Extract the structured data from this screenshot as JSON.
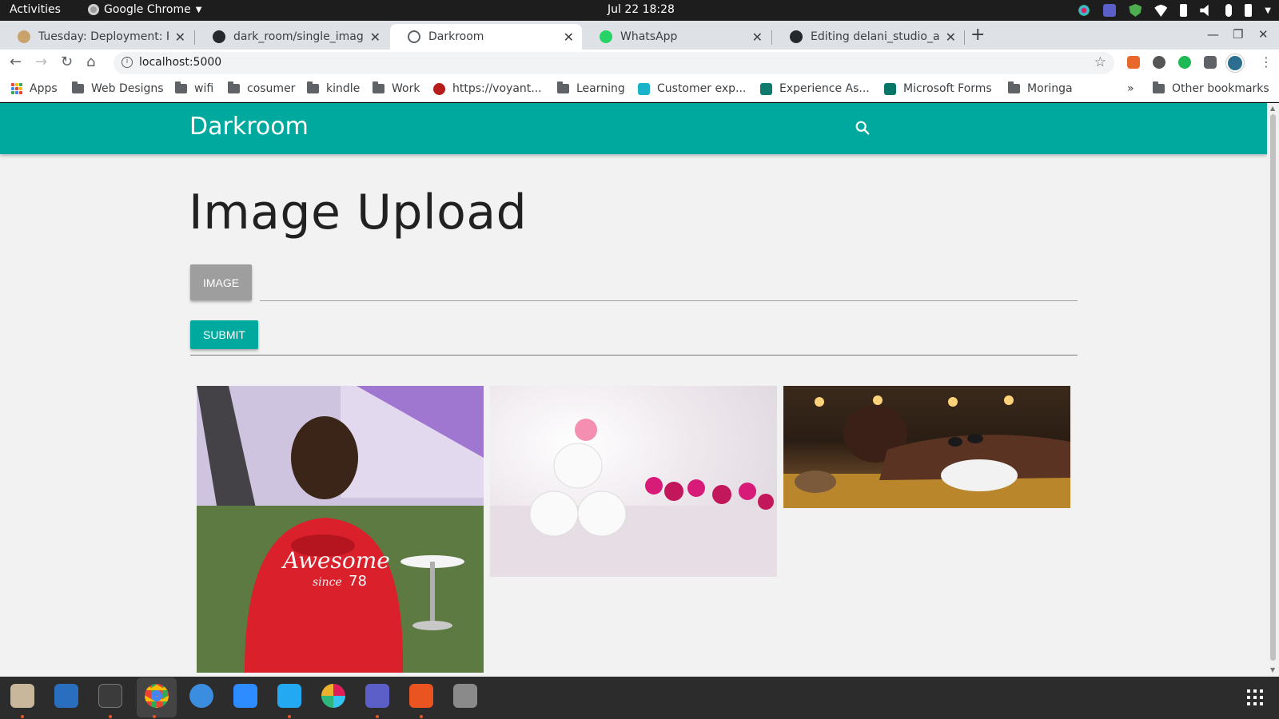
{
  "system": {
    "activities": "Activities",
    "app_name": "Google Chrome",
    "clock": "Jul 22  18:28"
  },
  "browser": {
    "tabs": [
      {
        "title": "Tuesday: Deployment: Pre",
        "active": false
      },
      {
        "title": "dark_room/single_image",
        "active": false
      },
      {
        "title": "Darkroom",
        "active": true
      },
      {
        "title": "WhatsApp",
        "active": false
      },
      {
        "title": "Editing delani_studio_app",
        "active": false
      }
    ],
    "url": "localhost:5000",
    "bookmarks": [
      {
        "label": "Apps",
        "icon": "apps-grid-icon"
      },
      {
        "label": "Web Designs",
        "icon": "folder-icon"
      },
      {
        "label": "wifi",
        "icon": "folder-icon"
      },
      {
        "label": "cosumer",
        "icon": "folder-icon"
      },
      {
        "label": "kindle",
        "icon": "folder-icon"
      },
      {
        "label": "Work",
        "icon": "folder-icon"
      },
      {
        "label": "https://voyant...",
        "icon": "voyant-icon"
      },
      {
        "label": "Learning",
        "icon": "folder-icon"
      },
      {
        "label": "Customer exp...",
        "icon": "customer-icon"
      },
      {
        "label": "Experience As...",
        "icon": "experience-icon"
      },
      {
        "label": "Microsoft Forms",
        "icon": "forms-icon"
      },
      {
        "label": "Moringa",
        "icon": "folder-icon"
      }
    ],
    "more_bookmarks": "»",
    "other_bookmarks": "Other bookmarks"
  },
  "page": {
    "brand": "Darkroom",
    "title": "Image Upload",
    "image_button": "IMAGE",
    "file_path_value": "",
    "submit_button": "SUBMIT",
    "gallery": [
      {
        "subject": "man in red hoodie",
        "printed_text": "Awesome since 78"
      },
      {
        "subject": "rolled white towels with pink orchids"
      },
      {
        "subject": "woman receiving hot stone massage"
      }
    ]
  },
  "colors": {
    "primary": "#00a99d",
    "page_bg": "#f2f2f2",
    "image_button_bg": "#9e9e9e"
  },
  "dock": {
    "apps": [
      "files",
      "text-editor",
      "terminal",
      "chrome",
      "simplenote",
      "zoom",
      "vscode",
      "slack",
      "teams",
      "software-center",
      "disk-utility"
    ]
  }
}
